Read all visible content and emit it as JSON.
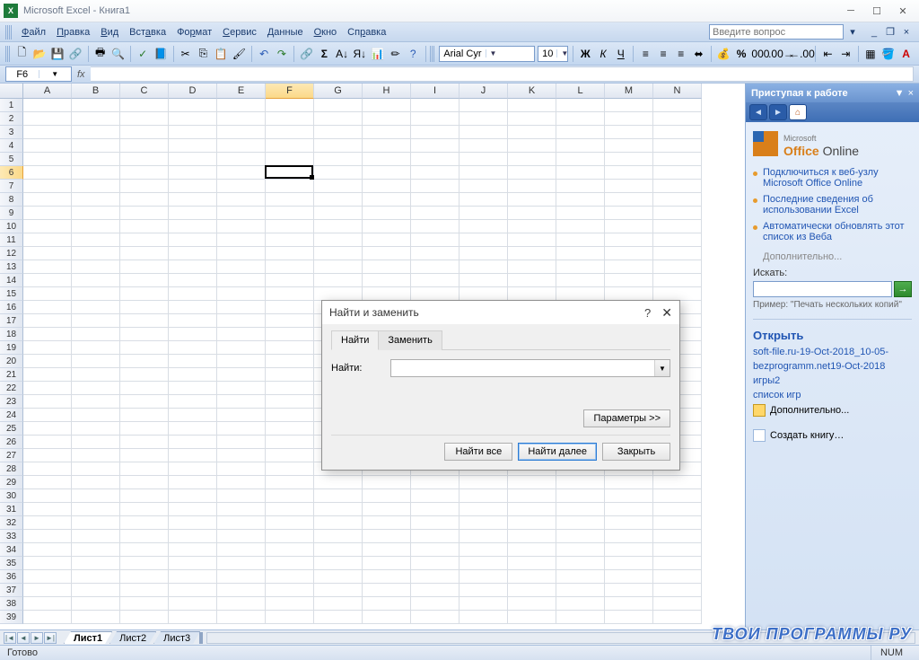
{
  "title": "Microsoft Excel - Книга1",
  "menu": [
    "Файл",
    "Правка",
    "Вид",
    "Вставка",
    "Формат",
    "Сервис",
    "Данные",
    "Окно",
    "Справка"
  ],
  "menu_underline_idx": [
    0,
    0,
    0,
    3,
    2,
    0,
    0,
    0,
    2
  ],
  "ask_placeholder": "Введите вопрос",
  "font_name": "Arial Cyr",
  "font_size": "10",
  "namebox": "F6",
  "columns": [
    "A",
    "B",
    "C",
    "D",
    "E",
    "F",
    "G",
    "H",
    "I",
    "J",
    "K",
    "L",
    "M",
    "N"
  ],
  "active_col": "F",
  "row_count": 39,
  "active_row": 6,
  "sheet_tabs": [
    "Лист1",
    "Лист2",
    "Лист3"
  ],
  "active_sheet": 0,
  "status_left": "Готово",
  "status_right": "NUM",
  "taskpane": {
    "title": "Приступая к работе",
    "office_online": {
      "small": "Microsoft",
      "brand": "Office",
      "suffix": "Online"
    },
    "links": [
      "Подключиться к веб-узлу Microsoft Office Online",
      "Последние сведения об использовании Excel",
      "Автоматически обновлять этот список из Веба"
    ],
    "more": "Дополнительно...",
    "search_label": "Искать:",
    "example_label": "Пример:",
    "example_text": "\"Печать нескольких копий\"",
    "open_title": "Открыть",
    "recent": [
      "soft-file.ru-19-Oct-2018_10-05-",
      "bezprogramm.net19-Oct-2018",
      "игры2",
      "список игр"
    ],
    "open_more": "Дополнительно...",
    "new_book": "Создать книгу…"
  },
  "dialog": {
    "title": "Найти и заменить",
    "tab_find": "Найти",
    "tab_replace": "Заменить",
    "find_label": "Найти:",
    "options": "Параметры >>",
    "find_all": "Найти все",
    "find_next": "Найти далее",
    "close": "Закрыть"
  },
  "watermark": "ТВОИ ПРОГРАММЫ РУ"
}
